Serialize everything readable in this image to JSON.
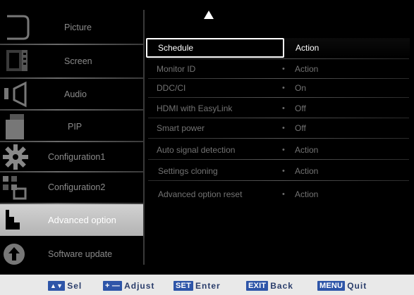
{
  "sidebar": {
    "items": [
      {
        "label": "Picture",
        "icon": "picture-icon",
        "selected": false
      },
      {
        "label": "Screen",
        "icon": "screen-icon",
        "selected": false
      },
      {
        "label": "Audio",
        "icon": "audio-icon",
        "selected": false
      },
      {
        "label": "PIP",
        "icon": "pip-icon",
        "selected": false
      },
      {
        "label": "Configuration1",
        "icon": "configuration1-icon",
        "selected": false
      },
      {
        "label": "Configuration2",
        "icon": "configuration2-icon",
        "selected": false
      },
      {
        "label": "Advanced option",
        "icon": "advanced-option-icon",
        "selected": true
      },
      {
        "label": "Software update",
        "icon": "software-update-icon",
        "selected": false
      }
    ]
  },
  "menu": {
    "rows": [
      {
        "name": "Schedule",
        "value": "Action",
        "selected": true
      },
      {
        "name": "Monitor ID",
        "value": "Action",
        "selected": false
      },
      {
        "name": "DDC/CI",
        "value": "On",
        "selected": false
      },
      {
        "name": "HDMI with EasyLink",
        "value": "Off",
        "selected": false
      },
      {
        "name": "Smart power",
        "value": "Off",
        "selected": false
      },
      {
        "name": "Auto signal detection",
        "value": "Action",
        "selected": false
      },
      {
        "name": "Settings cloning",
        "value": "Action",
        "selected": false
      },
      {
        "name": "Advanced option reset",
        "value": "Action",
        "selected": false
      }
    ],
    "separator": "•"
  },
  "footer": {
    "hints": [
      {
        "key": "▲▼",
        "label": "Sel"
      },
      {
        "key": "+ —",
        "label": "Adjust"
      },
      {
        "key": "SET",
        "label": "Enter"
      },
      {
        "key": "EXIT",
        "label": "Back"
      },
      {
        "key": "MENU",
        "label": "Quit"
      }
    ]
  },
  "colors": {
    "osd_background": "#000000",
    "key_blue": "#2e55a8",
    "hint_text": "#2a3d6b",
    "selected_sidebar": "#c4c4c4",
    "dim_text": "#737373"
  }
}
